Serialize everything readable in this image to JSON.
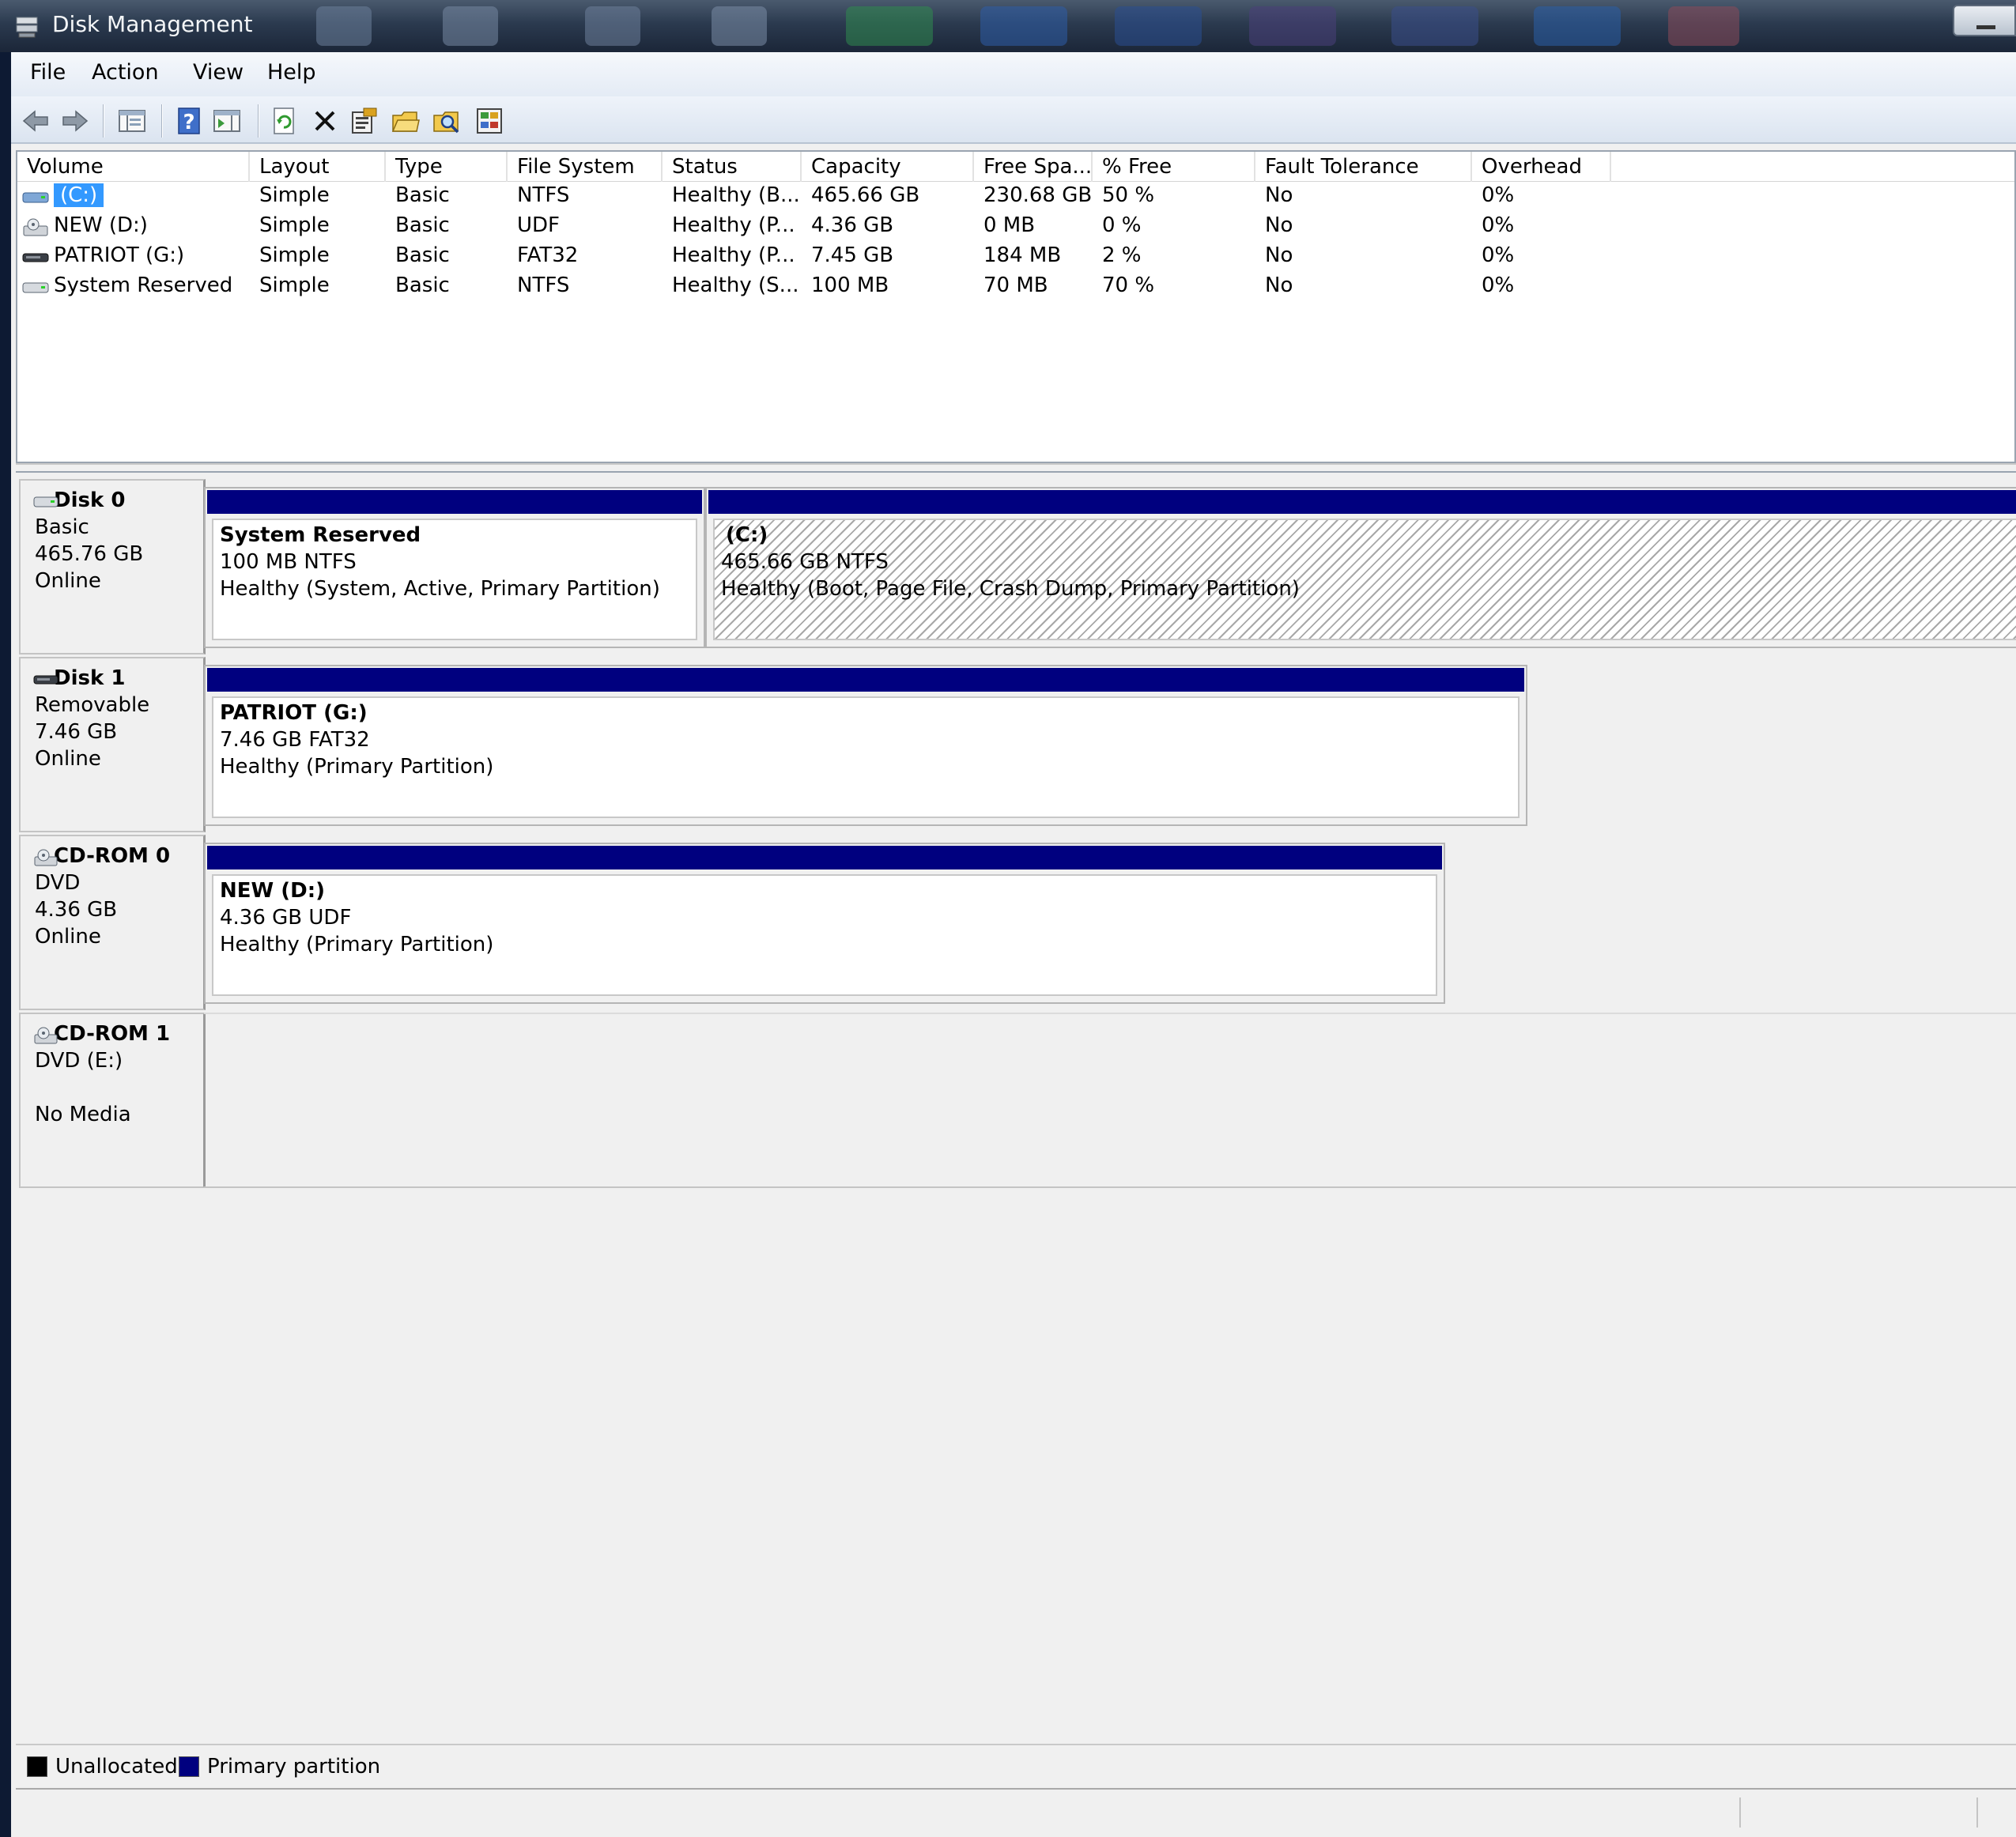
{
  "window": {
    "title": "Disk Management"
  },
  "menu": [
    "File",
    "Action",
    "View",
    "Help"
  ],
  "toolbar": [
    "back-icon",
    "forward-icon",
    "show-hide-console-tree-icon",
    "help-icon",
    "show-hide-action-pane-icon",
    "refresh-icon",
    "delete-icon",
    "properties-icon",
    "open-icon",
    "explore-icon",
    "rescan-disks-icon"
  ],
  "volume_list": {
    "columns": [
      "Volume",
      "Layout",
      "Type",
      "File System",
      "Status",
      "Capacity",
      "Free Spa...",
      "% Free",
      "Fault Tolerance",
      "Overhead"
    ],
    "rows": [
      {
        "icon": "hard-disk-icon",
        "cells": [
          "(C:)",
          "Simple",
          "Basic",
          "NTFS",
          "Healthy (B...",
          "465.66 GB",
          "230.68 GB",
          "50 %",
          "No",
          "0%"
        ]
      },
      {
        "icon": "cd-drive-icon",
        "cells": [
          "NEW (D:)",
          "Simple",
          "Basic",
          "UDF",
          "Healthy (P...",
          "4.36 GB",
          "0 MB",
          "0 %",
          "No",
          "0%"
        ]
      },
      {
        "icon": "removable-drive-icon",
        "cells": [
          "PATRIOT (G:)",
          "Simple",
          "Basic",
          "FAT32",
          "Healthy (P...",
          "7.45 GB",
          "184 MB",
          "2 %",
          "No",
          "0%"
        ]
      },
      {
        "icon": "hard-disk-icon",
        "cells": [
          "System Reserved",
          "Simple",
          "Basic",
          "NTFS",
          "Healthy (S...",
          "100 MB",
          "70 MB",
          "70 %",
          "No",
          "0%"
        ]
      }
    ]
  },
  "disks": [
    {
      "icon": "hard-disk-icon",
      "name": "Disk 0",
      "lines": [
        "Basic",
        "465.76 GB",
        "Online"
      ],
      "partitions": [
        {
          "title": "System Reserved",
          "size": "100 MB NTFS",
          "status": "Healthy (System, Active, Primary Partition)",
          "selected": false
        },
        {
          "title": "(C:)",
          "size": "465.66 GB NTFS",
          "status": "Healthy (Boot, Page File, Crash Dump, Primary Partition)",
          "selected": true
        }
      ]
    },
    {
      "icon": "removable-drive-icon",
      "name": "Disk 1",
      "lines": [
        "Removable",
        "7.46 GB",
        "Online"
      ],
      "partitions": [
        {
          "title": "PATRIOT  (G:)",
          "size": "7.46 GB FAT32",
          "status": "Healthy (Primary Partition)",
          "selected": false
        }
      ]
    },
    {
      "icon": "cd-drive-icon",
      "name": "CD-ROM 0",
      "lines": [
        "DVD",
        "4.36 GB",
        "Online"
      ],
      "partitions": [
        {
          "title": "NEW  (D:)",
          "size": "4.36 GB UDF",
          "status": "Healthy (Primary Partition)",
          "selected": false
        }
      ]
    },
    {
      "icon": "cd-drive-icon",
      "name": "CD-ROM 1",
      "lines": [
        "DVD (E:)",
        "",
        "No Media"
      ],
      "partitions": []
    }
  ],
  "legend": [
    {
      "label": "Unallocated",
      "color": "#000000"
    },
    {
      "label": "Primary partition",
      "color": "#00007f"
    }
  ],
  "colors": {
    "primary_partition": "#00007f",
    "selection": "#3399ff",
    "unallocated": "#000000"
  }
}
